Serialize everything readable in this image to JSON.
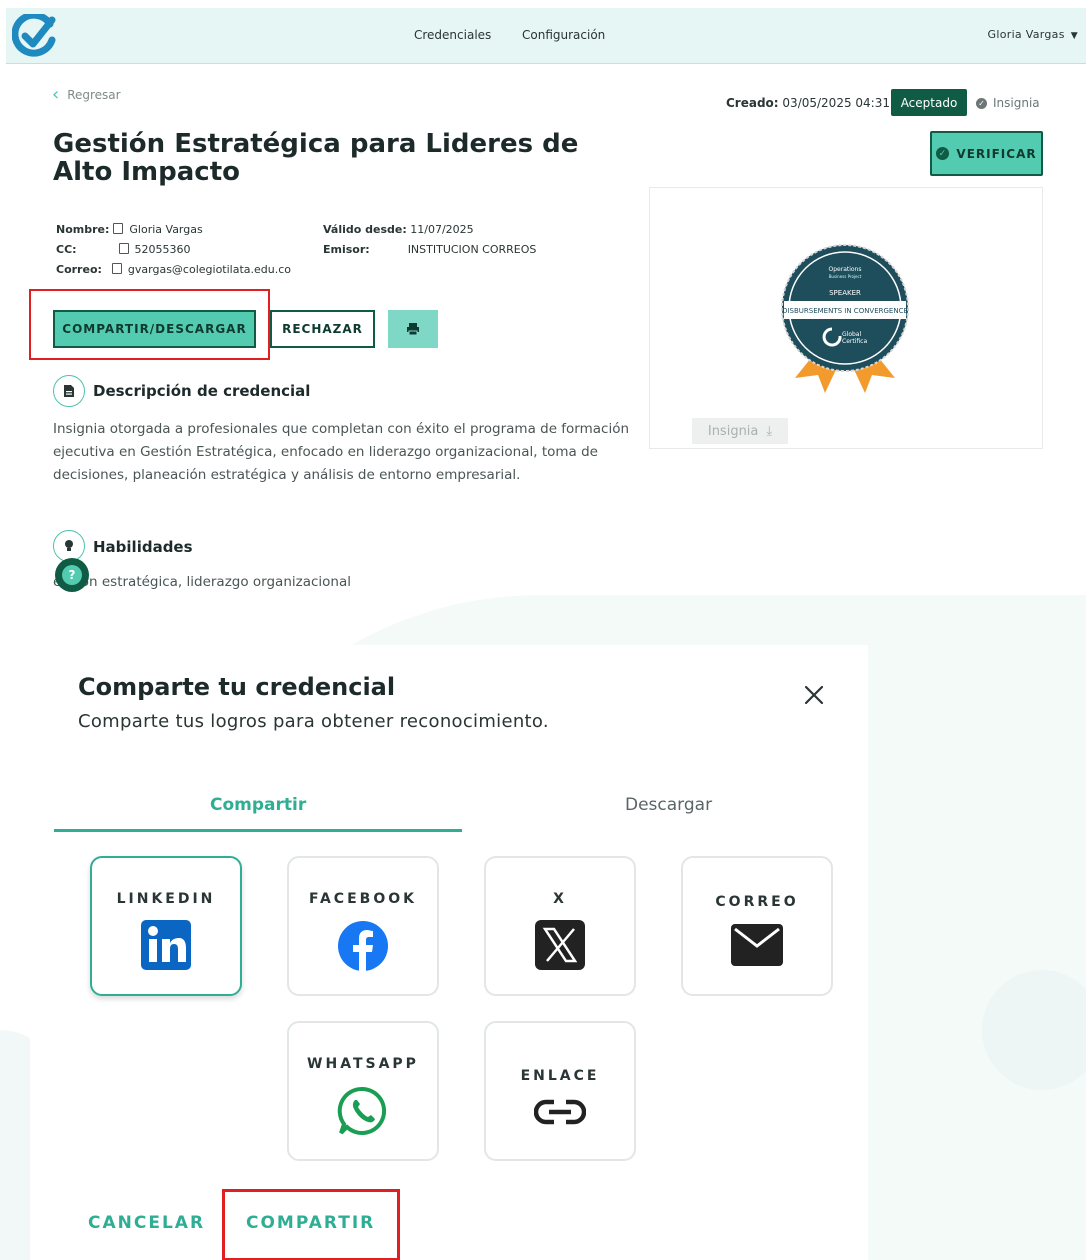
{
  "nav": {
    "links": [
      "Credenciales",
      "Configuración"
    ],
    "user": "Gloria Vargas"
  },
  "back_label": "Regresar",
  "meta": {
    "created_label": "Creado:",
    "created_value": "03/05/2025 04:31",
    "status": "Aceptado",
    "type": "Insignia"
  },
  "credential": {
    "title": "Gestión Estratégica para Lideres de Alto Impacto",
    "name_label": "Nombre:",
    "name": "Gloria Vargas",
    "cc_label": "CC:",
    "cc": "52055360",
    "email_label": "Correo:",
    "email": "gvargas@colegiotilata.edu.co",
    "valid_label": "Válido desde:",
    "valid": "11/07/2025",
    "issuer_label": "Emisor:",
    "issuer": "INSTITUCION CORREOS"
  },
  "actions": {
    "verify": "VERIFICAR",
    "share": "COMPARTIR/DESCARGAR",
    "reject": "RECHAZAR"
  },
  "badge_card": {
    "button": "Insignia"
  },
  "badge_art": {
    "top_line1": "Operations",
    "top_line2": "Business Project",
    "speaker": "SPEAKER",
    "banner": "DISBURSEMENTS IN CONVERGENCE",
    "brand1": "Global",
    "brand2": "Certifica"
  },
  "description": {
    "heading": "Descripción de credencial",
    "text": "Insignia otorgada a profesionales que completan con éxito el programa de formación ejecutiva en Gestión Estratégica, enfocado en liderazgo organizacional, toma de decisiones, planeación estratégica y análisis de entorno empresarial."
  },
  "skills": {
    "heading": "Habilidades",
    "text": "eación estratégica, liderazgo organizacional"
  },
  "help_label": "?",
  "modal": {
    "title": "Comparte tu credencial",
    "subtitle": "Comparte tus logros para obtener reconocimiento.",
    "tabs": [
      "Compartir",
      "Descargar"
    ],
    "options": [
      "LINKEDIN",
      "FACEBOOK",
      "X",
      "CORREO",
      "WHATSAPP",
      "ENLACE"
    ],
    "cancel": "CANCELAR",
    "submit": "COMPARTIR"
  },
  "colors": {
    "accent": "#52cbb0",
    "dark": "#0f5b43",
    "tab_active": "#2fae94",
    "highlight": "#e02020",
    "linkedin": "#0a66c2",
    "facebook": "#1877f2"
  }
}
